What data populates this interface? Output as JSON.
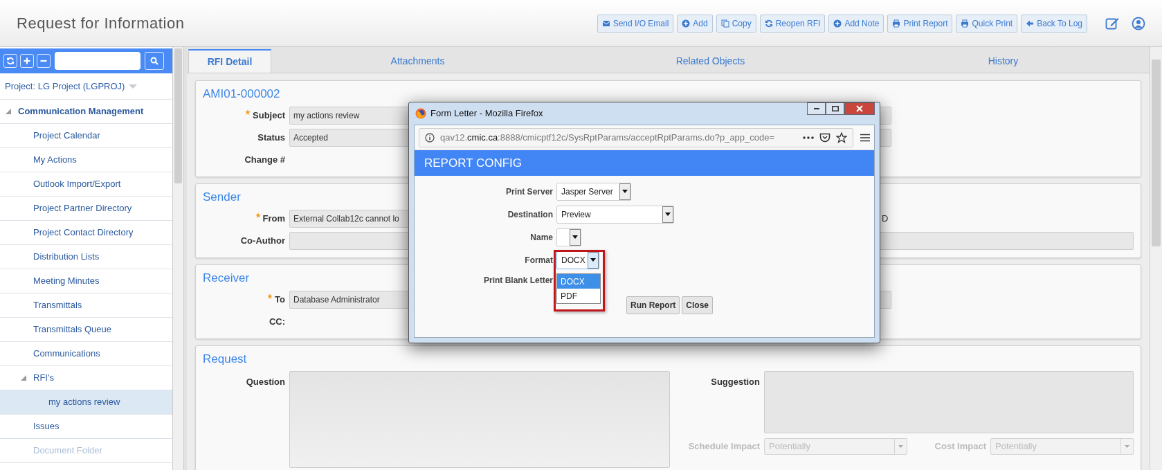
{
  "header": {
    "title": "Request for Information",
    "actions": [
      "Send I/O Email",
      "Add",
      "Copy",
      "Reopen RFI",
      "Add Note",
      "Print Report",
      "Quick Print",
      "Back To Log"
    ]
  },
  "sidebar": {
    "project": "Project: LG Project (LGPROJ)",
    "tree": [
      {
        "label": "Communication Management",
        "expanded": true,
        "selected": false,
        "disabled": false,
        "children": [
          {
            "label": "Project Calendar",
            "selected": false,
            "disabled": false
          },
          {
            "label": "My Actions",
            "selected": false,
            "disabled": false
          },
          {
            "label": "Outlook Import/Export",
            "selected": false,
            "disabled": false
          },
          {
            "label": "Project Partner Directory",
            "selected": false,
            "disabled": false
          },
          {
            "label": "Project Contact Directory",
            "selected": false,
            "disabled": false
          },
          {
            "label": "Distribution Lists",
            "selected": false,
            "disabled": false
          },
          {
            "label": "Meeting Minutes",
            "selected": false,
            "disabled": false
          },
          {
            "label": "Transmittals",
            "selected": false,
            "disabled": false
          },
          {
            "label": "Transmittals Queue",
            "selected": false,
            "disabled": false
          },
          {
            "label": "Communications",
            "selected": false,
            "disabled": false
          },
          {
            "label": "RFI's",
            "expanded": true,
            "selected": false,
            "disabled": false,
            "children": [
              {
                "label": "my actions review",
                "selected": true,
                "disabled": false
              }
            ]
          },
          {
            "label": "Issues",
            "selected": false,
            "disabled": false
          },
          {
            "label": "Document Folder",
            "selected": false,
            "disabled": true
          }
        ]
      }
    ]
  },
  "tabs": [
    {
      "label": "RFI Detail",
      "selected": true
    },
    {
      "label": "Attachments",
      "selected": false
    },
    {
      "label": "Related Objects",
      "selected": false
    },
    {
      "label": "History",
      "selected": false
    }
  ],
  "sections": [
    {
      "title": "AMI01-000002",
      "fields": [
        {
          "label": "Subject",
          "required": true,
          "kind": "input",
          "value": "my actions review"
        },
        {
          "label": "Status",
          "required": false,
          "kind": "input",
          "value": "Accepted"
        },
        {
          "label": "Change #",
          "required": false,
          "kind": "label"
        }
      ]
    },
    {
      "title": "Sender",
      "fields": [
        {
          "label": "From",
          "required": true,
          "kind": "input",
          "value": "External Collab12c cannot lo",
          "trailing": "D"
        },
        {
          "label": "Co-Author",
          "required": false,
          "kind": "wide"
        }
      ]
    },
    {
      "title": "Receiver",
      "fields": [
        {
          "label": "To",
          "required": true,
          "kind": "input",
          "value": "Database Administrator"
        },
        {
          "label": "CC:",
          "required": false,
          "kind": "label"
        }
      ]
    }
  ],
  "request": {
    "title": "Request",
    "question": "Question",
    "suggestion": "Suggestion",
    "selects": [
      {
        "label": "Schedule Impact",
        "value": "Potentially",
        "disabled": true
      },
      {
        "label": "Cost Impact",
        "value": "Potentially",
        "disabled": true
      }
    ]
  },
  "dialog": {
    "window_title": "Form Letter - Mozilla Firefox",
    "url": {
      "prefix": "qav12.",
      "domain": "cmic.ca",
      "path": ":8888/cmicptf12c/SysRptParams/acceptRptParams.do?p_app_code="
    },
    "heading": "REPORT CONFIG",
    "fields": [
      {
        "label": "Print Server",
        "kind": "select",
        "value": "Jasper Server"
      },
      {
        "label": "Destination",
        "kind": "select",
        "value": "Preview"
      },
      {
        "label": "Name",
        "kind": "select"
      },
      {
        "label": "Format",
        "kind": "select",
        "value": "DOCX",
        "expanded": true,
        "options": [
          {
            "label": "DOCX",
            "selected": true
          },
          {
            "label": "PDF",
            "selected": false
          }
        ]
      },
      {
        "label": "Print Blank Letter",
        "kind": "label"
      }
    ],
    "buttons": [
      "Run Report",
      "Close"
    ]
  }
}
